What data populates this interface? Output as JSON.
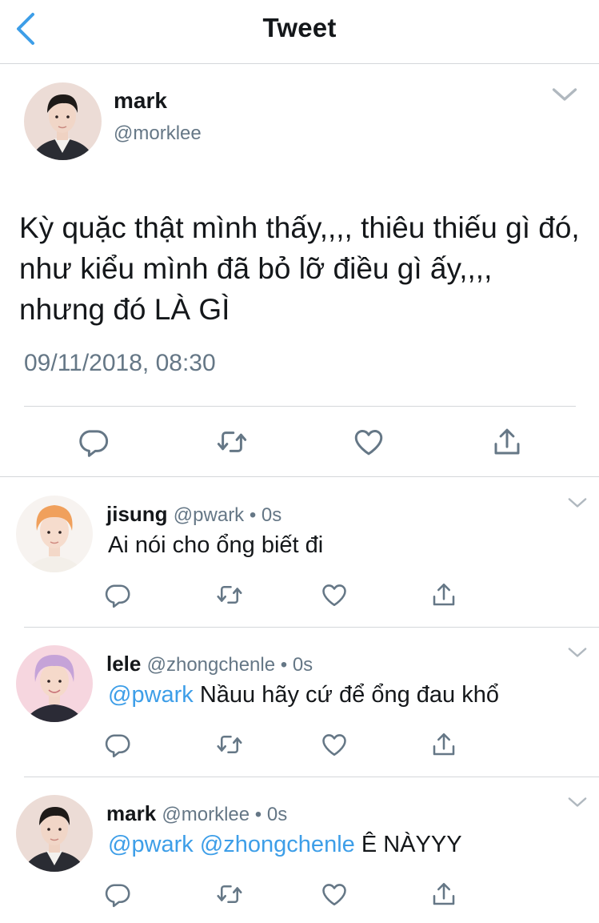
{
  "header": {
    "title": "Tweet",
    "back_icon": "chevron-left-icon"
  },
  "colors": {
    "accent": "#3d9ee8",
    "text": "#14171a",
    "secondary": "#657786",
    "divider": "#d4d7da",
    "icon": "#657786"
  },
  "main_tweet": {
    "name": "mark",
    "handle": "@morklee",
    "text": "Kỳ quặc thật mình thấy,,,, thiêu thiếu gì đó, như kiểu mình đã bỏ lỡ điều gì ấy,,,, nhưng đó LÀ GÌ",
    "timestamp": "09/11/2018, 08:30"
  },
  "replies": [
    {
      "name": "jisung",
      "meta": "@pwark • 0s",
      "mentions": "",
      "text": "Ai nói cho ổng biết đi"
    },
    {
      "name": "lele",
      "meta": "@zhongchenle • 0s",
      "mentions": "@pwark",
      "text": "Nầuu hãy cứ để ổng đau khổ"
    },
    {
      "name": "mark",
      "meta": "@morklee • 0s",
      "mentions": "@pwark @zhongchenle",
      "text": "Ê NÀYYY"
    }
  ],
  "actions": [
    "reply-icon",
    "retweet-icon",
    "like-icon",
    "share-icon"
  ]
}
